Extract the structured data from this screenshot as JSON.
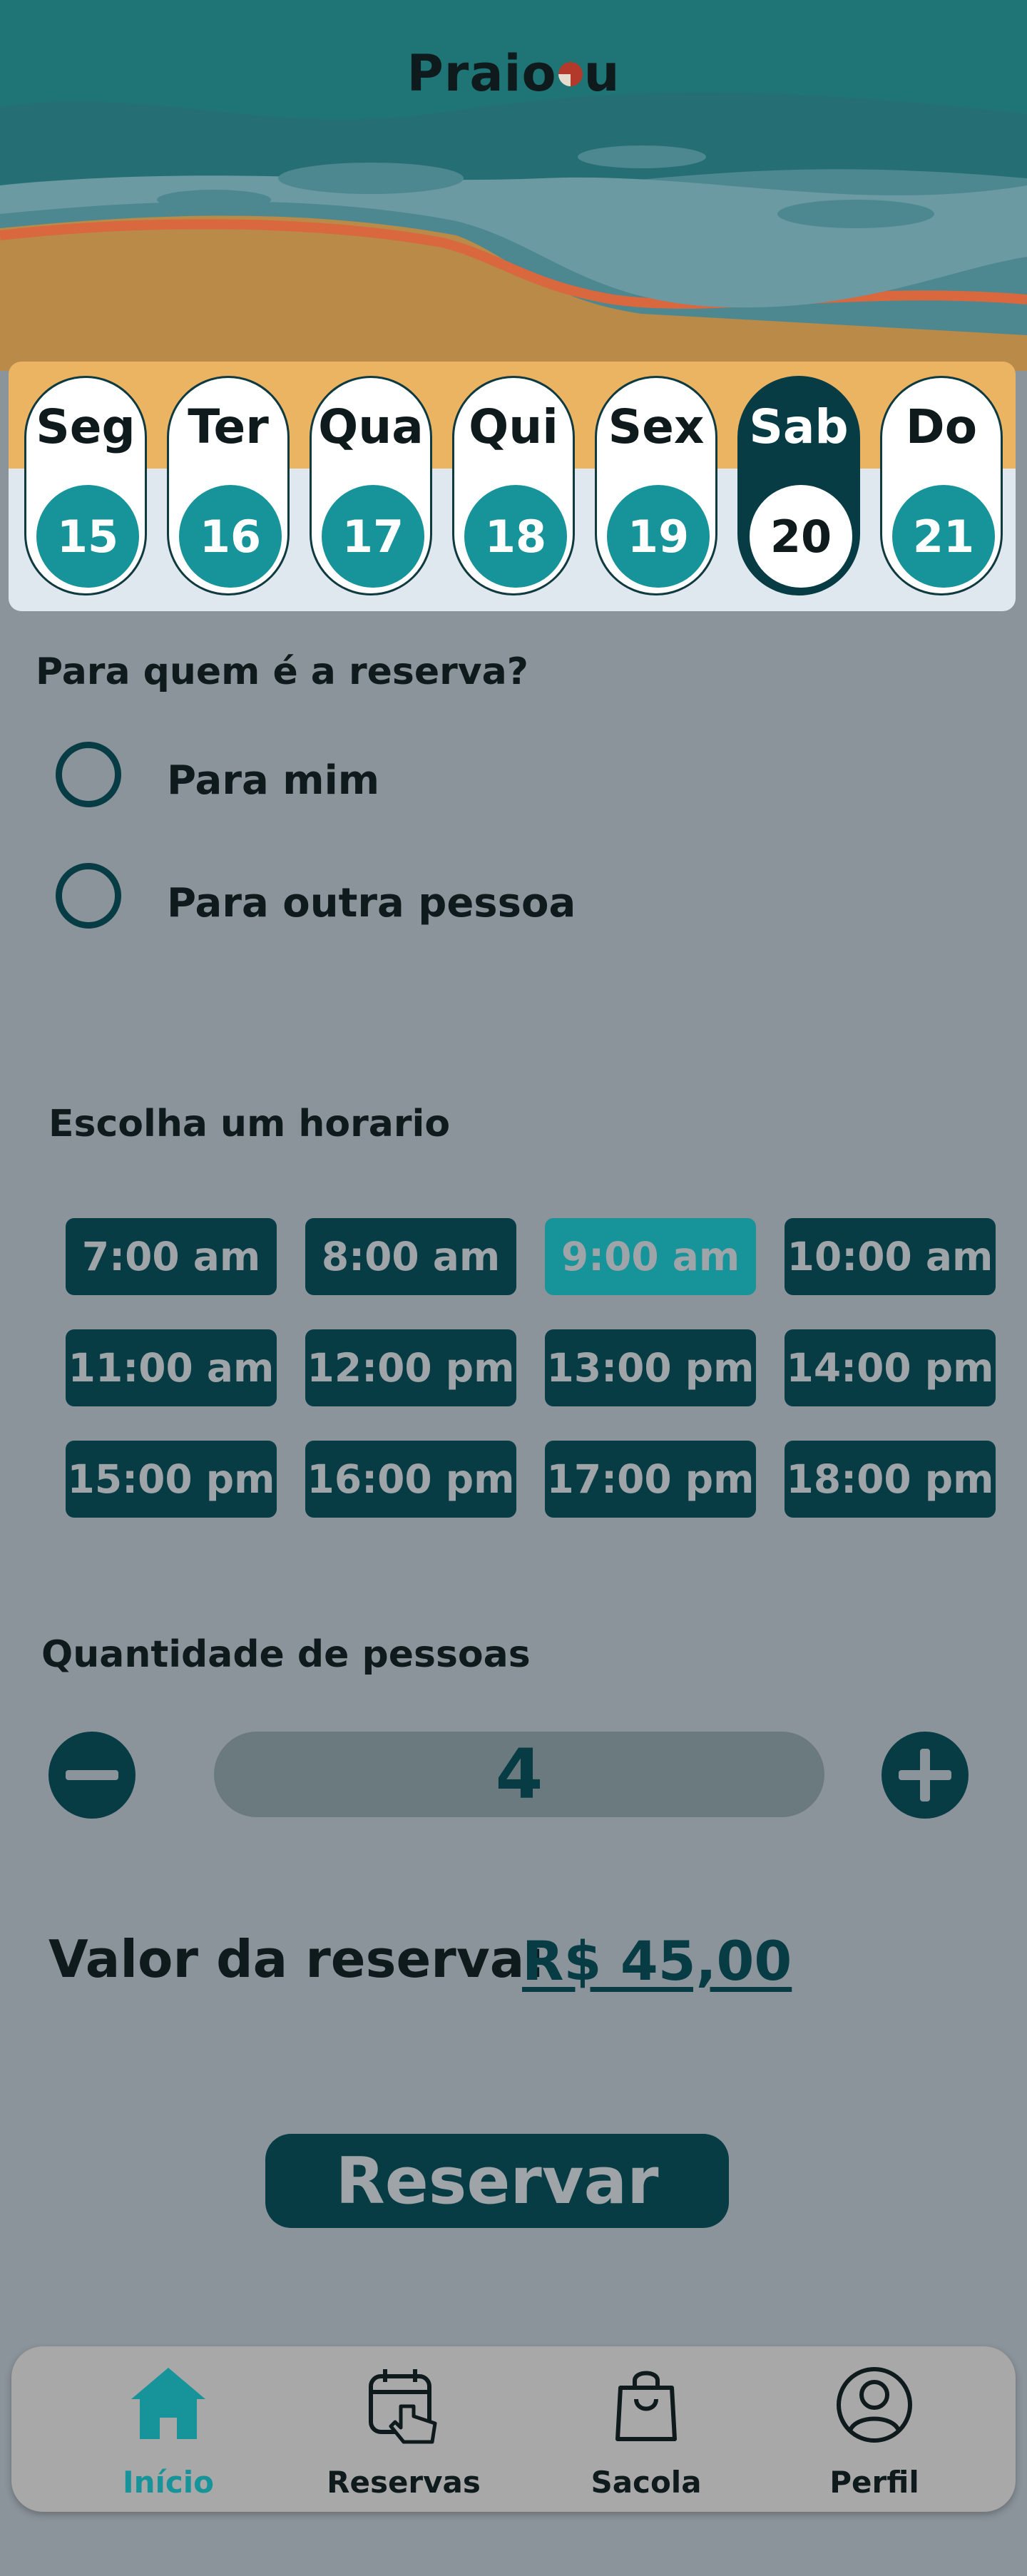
{
  "app": {
    "logo_text_a": "Praio",
    "logo_text_b": "u"
  },
  "dates": [
    {
      "day": "Seg",
      "num": "15",
      "selected": false
    },
    {
      "day": "Ter",
      "num": "16",
      "selected": false
    },
    {
      "day": "Qua",
      "num": "17",
      "selected": false
    },
    {
      "day": "Qui",
      "num": "18",
      "selected": false
    },
    {
      "day": "Sex",
      "num": "19",
      "selected": false
    },
    {
      "day": "Sab",
      "num": "20",
      "selected": true
    },
    {
      "day": "Do",
      "num": "21",
      "selected": false
    }
  ],
  "booking_for": {
    "question": "Para quem é a reserva?",
    "options": [
      "Para mim",
      "Para outra pessoa"
    ]
  },
  "schedule": {
    "title": "Escolha um horario",
    "slots": [
      "7:00 am",
      "8:00 am",
      "9:00 am",
      "10:00 am",
      "11:00 am",
      "12:00 pm",
      "13:00 pm",
      "14:00 pm",
      "15:00 pm",
      "16:00 pm",
      "17:00 pm",
      "18:00 pm"
    ],
    "selected": "9:00 am"
  },
  "people": {
    "title": "Quantidade de pessoas",
    "value": "4"
  },
  "price": {
    "label": "Valor da reserva:",
    "value": "R$ 45,00"
  },
  "reserve_button": "Reservar",
  "tabs": [
    {
      "label": "Início",
      "icon": "home-icon",
      "active": true
    },
    {
      "label": "Reservas",
      "icon": "calendar-touch-icon",
      "active": false
    },
    {
      "label": "Sacola",
      "icon": "shopping-bag-icon",
      "active": false
    },
    {
      "label": "Perfil",
      "icon": "profile-icon",
      "active": false
    }
  ],
  "colors": {
    "accent": "#17939a",
    "dark_teal": "#073c45",
    "background": "#8b949b",
    "sand": "#ebb463"
  }
}
